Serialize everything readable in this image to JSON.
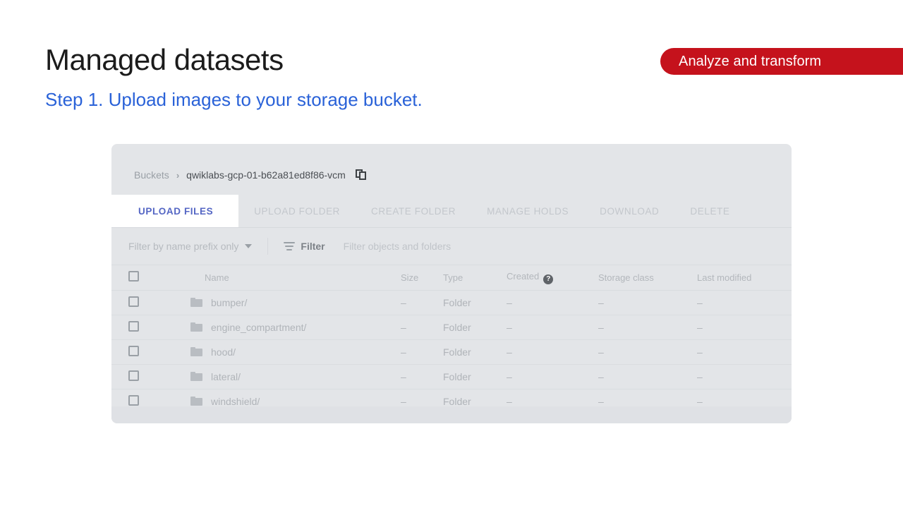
{
  "slide": {
    "title": "Managed datasets",
    "subtitle": "Step 1. Upload images to your storage bucket.",
    "badge_label": "Analyze and transform",
    "badge_color": "#c5121c",
    "subtitle_color": "#2a62d8"
  },
  "console": {
    "breadcrumb": {
      "root": "Buckets",
      "separator": "›",
      "current": "qwiklabs-gcp-01-b62a81ed8f86-vcm",
      "copy_icon": "copy-icon"
    },
    "tabs": [
      {
        "label": "UPLOAD FILES",
        "active": true
      },
      {
        "label": "UPLOAD FOLDER",
        "active": false
      },
      {
        "label": "CREATE FOLDER",
        "active": false
      },
      {
        "label": "MANAGE HOLDS",
        "active": false
      },
      {
        "label": "DOWNLOAD",
        "active": false
      },
      {
        "label": "DELETE",
        "active": false
      }
    ],
    "filter_bar": {
      "prefix_select": "Filter by name prefix only",
      "caret_icon": "chevron-down-icon",
      "filter_icon": "filter-icon",
      "filter_label": "Filter",
      "filter_placeholder": "Filter objects and folders"
    },
    "table": {
      "columns": [
        "Name",
        "Size",
        "Type",
        "Created",
        "Storage class",
        "Last modified"
      ],
      "created_help_icon": "help-icon",
      "rows": [
        {
          "name": "bumper/",
          "size": "–",
          "type": "Folder",
          "created": "–",
          "storage_class": "–",
          "last_modified": "–"
        },
        {
          "name": "engine_compartment/",
          "size": "–",
          "type": "Folder",
          "created": "–",
          "storage_class": "–",
          "last_modified": "–"
        },
        {
          "name": "hood/",
          "size": "–",
          "type": "Folder",
          "created": "–",
          "storage_class": "–",
          "last_modified": "–"
        },
        {
          "name": "lateral/",
          "size": "–",
          "type": "Folder",
          "created": "–",
          "storage_class": "–",
          "last_modified": "–"
        },
        {
          "name": "windshield/",
          "size": "–",
          "type": "Folder",
          "created": "–",
          "storage_class": "–",
          "last_modified": "–"
        }
      ]
    }
  }
}
